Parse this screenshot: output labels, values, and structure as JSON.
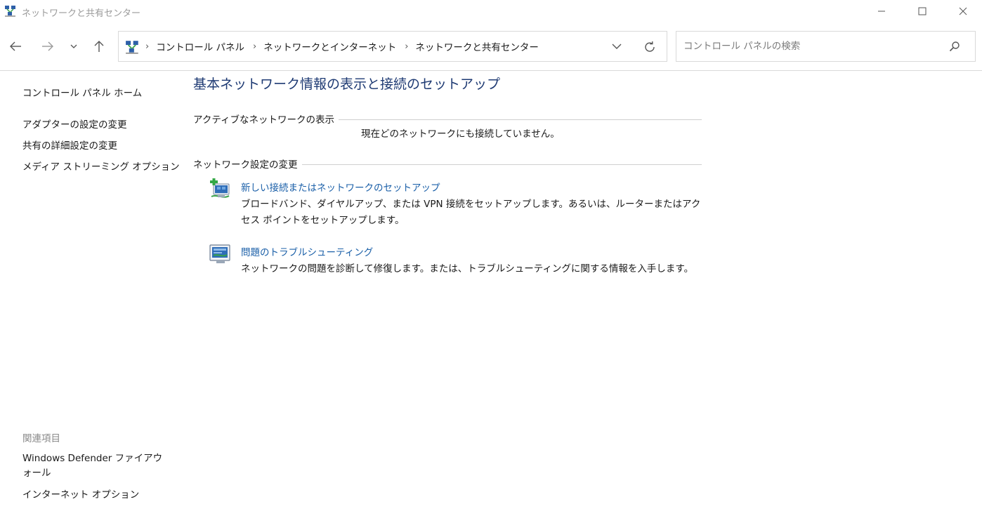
{
  "window": {
    "title": "ネットワークと共有センター"
  },
  "nav": {
    "breadcrumbs": [
      "コントロール パネル",
      "ネットワークとインターネット",
      "ネットワークと共有センター"
    ],
    "separator": "›"
  },
  "search": {
    "placeholder": "コントロール パネルの検索",
    "value": ""
  },
  "sidebar": {
    "home": "コントロール パネル ホーム",
    "items": [
      "アダプターの設定の変更",
      "共有の詳細設定の変更",
      "メディア ストリーミング オプション"
    ],
    "related_heading": "関連項目",
    "related": [
      "Windows Defender ファイアウォール",
      "インターネット オプション"
    ]
  },
  "main": {
    "title": "基本ネットワーク情報の表示と接続のセットアップ",
    "active_section": "アクティブなネットワークの表示",
    "no_network": "現在どのネットワークにも接続していません。",
    "change_section": "ネットワーク設定の変更",
    "tasks": [
      {
        "label": "新しい接続またはネットワークのセットアップ",
        "description": "ブロードバンド、ダイヤルアップ、または VPN 接続をセットアップします。あるいは、ルーターまたはアクセス ポイントをセットアップします。",
        "icon": "new-connection-icon"
      },
      {
        "label": "問題のトラブルシューティング",
        "description": "ネットワークの問題を診断して修復します。または、トラブルシューティングに関する情報を入手します。",
        "icon": "troubleshoot-icon"
      }
    ]
  },
  "colors": {
    "title_blue": "#1e3a73",
    "link_blue": "#1a5fa8",
    "muted_gray": "#8a8a8a",
    "border": "#d9d9d9"
  }
}
